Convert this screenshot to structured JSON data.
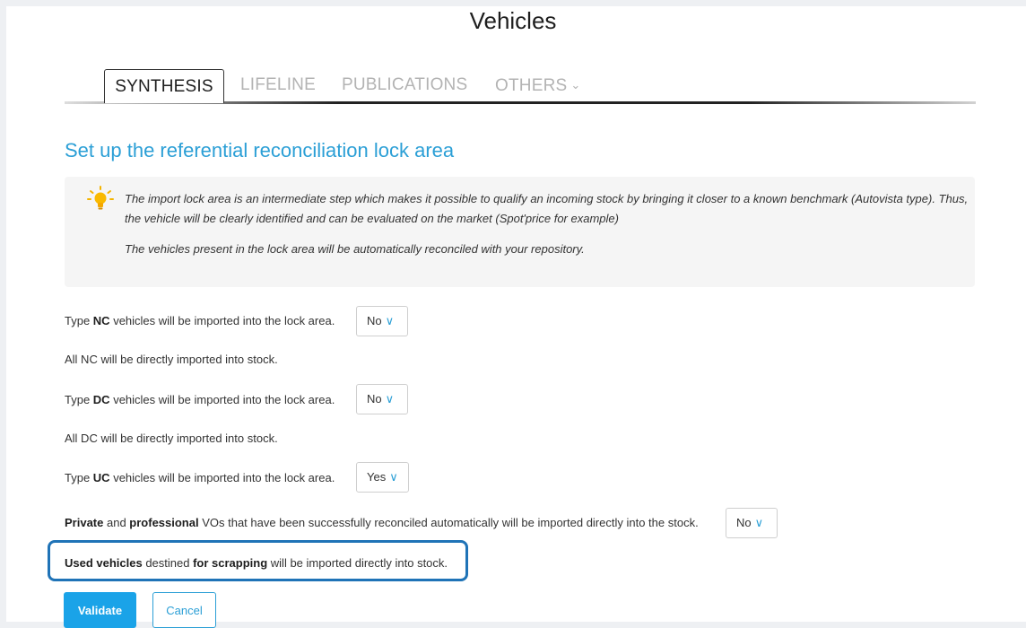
{
  "page": {
    "title": "Vehicles"
  },
  "tabs": [
    {
      "label": "SYNTHESIS",
      "active": true
    },
    {
      "label": "LIFELINE",
      "active": false
    },
    {
      "label": "PUBLICATIONS",
      "active": false
    },
    {
      "label": "OTHERS",
      "active": false,
      "icon": "chevron-down-icon"
    }
  ],
  "section": {
    "heading": "Set up the referential reconciliation lock area",
    "info": {
      "icon": "lightbulb-icon",
      "line1": "The import lock area is an intermediate step which makes it possible to qualify an incoming stock by bringing it closer to a known benchmark (Autovista type). Thus,",
      "line2": "the vehicle will be clearly identified and can be evaluated on the market (Spot'price for example)",
      "line3": "The vehicles present in the lock area will be automatically reconciled with your repository."
    }
  },
  "settings": {
    "nc": {
      "pre": "Type ",
      "bold": "NC",
      "post": " vehicles will be imported into the lock area.",
      "value": "No",
      "note": "All NC will be directly imported into stock."
    },
    "dc": {
      "pre": "Type ",
      "bold": "DC",
      "post": " vehicles will be imported into the lock area.",
      "value": "No",
      "note": "All DC will be directly imported into stock."
    },
    "uc": {
      "pre": "Type ",
      "bold": "UC",
      "post": " vehicles will be imported into the lock area.",
      "value": "Yes"
    },
    "vo": {
      "bold1": "Private",
      "mid1": " and ",
      "bold2": "professional",
      "post": " VOs that have been successfully reconciled automatically will be imported directly into the stock.",
      "value": "No"
    },
    "scrap": {
      "bold1": "Used vehicles",
      "mid1": " destined ",
      "bold2": "for scrapping",
      "post": " will be imported directly into stock."
    }
  },
  "colors": {
    "accent": "#2b9fd6",
    "button": "#1aa3e8",
    "highlight": "#1f73b7"
  },
  "buttons": {
    "validate": "Validate",
    "cancel": "Cancel"
  }
}
